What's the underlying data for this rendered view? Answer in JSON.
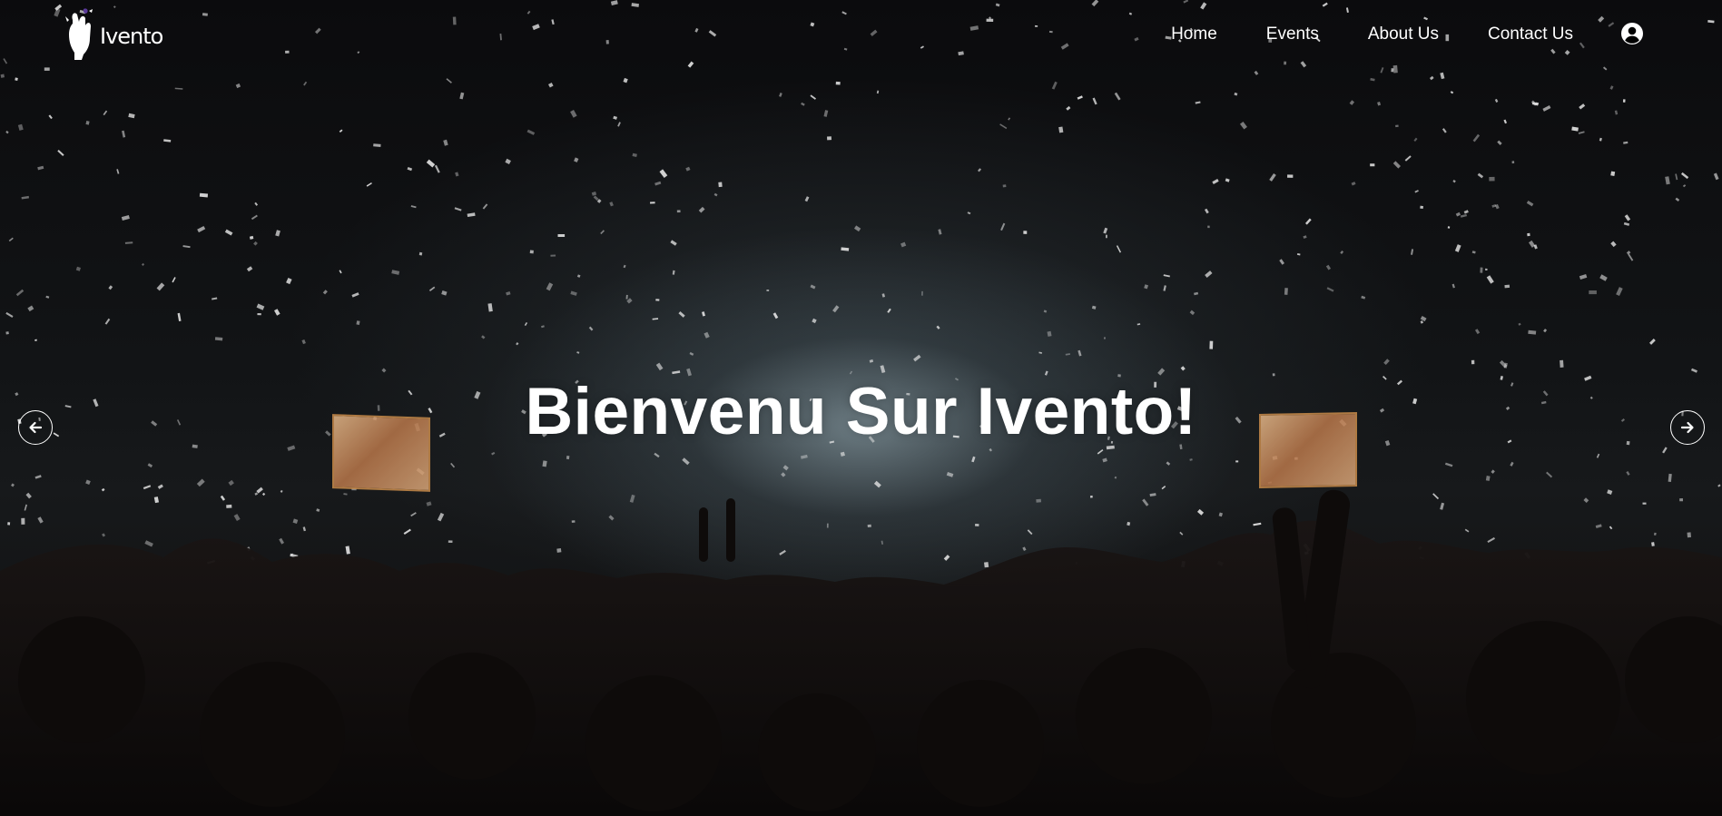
{
  "brand": {
    "name": "Ivento",
    "logo_icon": "raised-hand-logo-icon"
  },
  "nav": {
    "items": [
      {
        "label": "Home"
      },
      {
        "label": "Events"
      },
      {
        "label": "About Us"
      },
      {
        "label": "Contact Us"
      }
    ],
    "account_icon": "user-circle-icon"
  },
  "hero": {
    "title": "Bienvenu Sur Ivento!",
    "prev_icon": "arrow-left-icon",
    "next_icon": "arrow-right-icon"
  },
  "colors": {
    "text": "#ffffff",
    "background": "#0b0b0d"
  }
}
